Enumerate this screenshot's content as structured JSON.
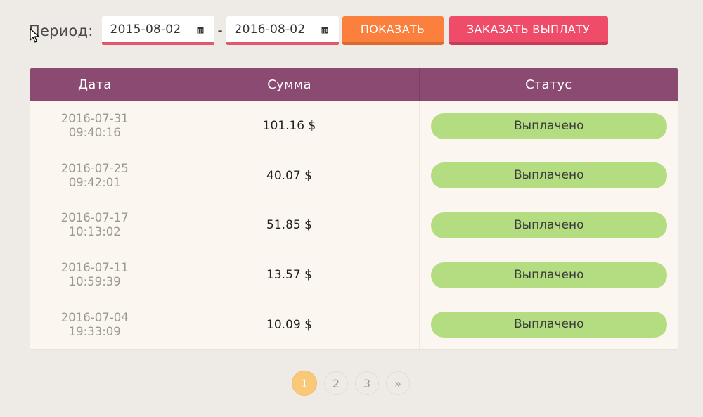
{
  "filter": {
    "period_label": "Период:",
    "date_from": "2015-08-02",
    "date_to": "2016-08-02",
    "separator": "-",
    "show_button": "ПОКАЗАТЬ",
    "order_payout_button": "ЗАКАЗАТЬ ВЫПЛАТУ"
  },
  "table": {
    "headers": [
      "Дата",
      "Сумма",
      "Статус"
    ],
    "rows": [
      {
        "date": "2016-07-31",
        "time": "09:40:16",
        "sum": "101.16 $",
        "status": "Выплачено"
      },
      {
        "date": "2016-07-25",
        "time": "09:42:01",
        "sum": "40.07 $",
        "status": "Выплачено"
      },
      {
        "date": "2016-07-17",
        "time": "10:13:02",
        "sum": "51.85 $",
        "status": "Выплачено"
      },
      {
        "date": "2016-07-11",
        "time": "10:59:39",
        "sum": "13.57 $",
        "status": "Выплачено"
      },
      {
        "date": "2016-07-04",
        "time": "19:33:09",
        "sum": "10.09 $",
        "status": "Выплачено"
      }
    ]
  },
  "pagination": {
    "pages": [
      "1",
      "2",
      "3"
    ],
    "current": "1",
    "next": "»"
  },
  "colors": {
    "header_bg": "#8b4a71",
    "show_button": "#fb7f3d",
    "order_button": "#ef4c6a",
    "status_paid": "#b4dd82",
    "active_page": "#f9c979",
    "input_underline": "#e2586f"
  },
  "icons": {
    "date_picker": "calendar-icon",
    "cursor": "mouse-pointer-icon"
  }
}
